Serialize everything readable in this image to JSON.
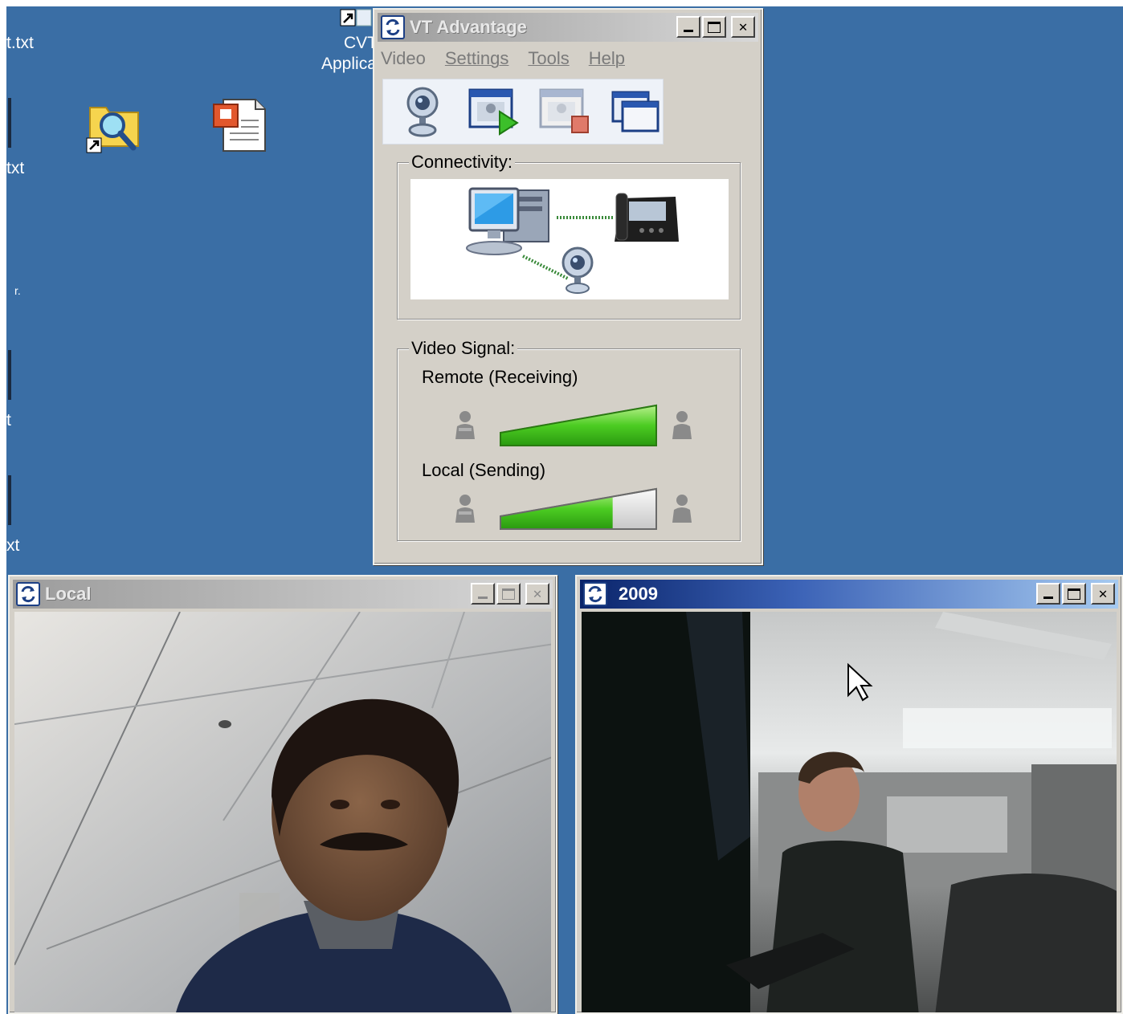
{
  "desktop": {
    "background": "#3a6ea5",
    "labels": [
      {
        "text": "t.txt"
      },
      {
        "text": "txt"
      },
      {
        "text": "r."
      },
      {
        "text": "t"
      },
      {
        "text": "xt"
      }
    ],
    "cvt_label_line1": "CVT",
    "cvt_label_line2": "Applica",
    "icons": [
      "search-shortcut-icon",
      "presentation-file-icon"
    ]
  },
  "vt_window": {
    "title": "VT Advantage",
    "menu": [
      "Video",
      "Settings",
      "Tools",
      "Help"
    ],
    "toolbar": [
      "camera-icon",
      "start-video-icon",
      "stop-video-icon",
      "switch-windows-icon"
    ],
    "connectivity_label": "Connectivity:",
    "video_signal_label": "Video Signal:",
    "remote_label": "Remote (Receiving)",
    "local_label": "Local (Sending)",
    "remote_level": 1.0,
    "local_level": 0.72,
    "accent_green": "#44cc22"
  },
  "local_window": {
    "title": "Local"
  },
  "remote_window": {
    "title": "2009"
  }
}
